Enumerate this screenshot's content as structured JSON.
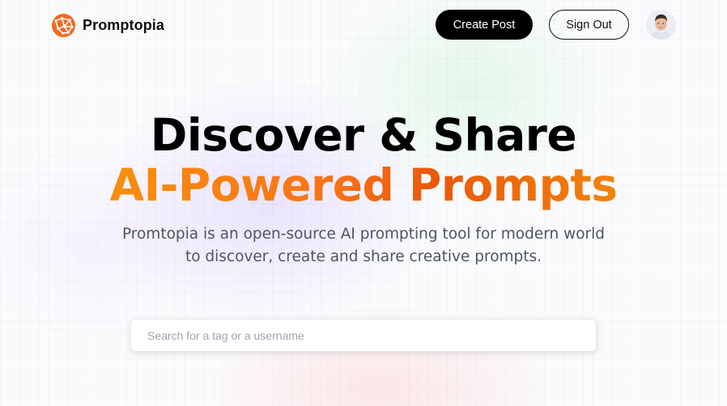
{
  "nav": {
    "brand_name": "Promptopia",
    "create_post_label": "Create Post",
    "sign_out_label": "Sign Out"
  },
  "hero": {
    "headline_line1": "Discover & Share",
    "headline_line2": "AI-Powered Prompts",
    "description": "Promtopia is an open-source AI prompting tool for modern world to discover, create and share creative prompts."
  },
  "search": {
    "placeholder": "Search for a tag or a username",
    "value": ""
  },
  "colors": {
    "brand_orange": "#f97316",
    "gradient_start": "#f59e0b",
    "gradient_mid": "#ea580c",
    "button_dark": "#000000",
    "description_text": "#4b5563"
  },
  "icons": {
    "logo": "promptopia-logo-icon",
    "avatar": "user-avatar"
  }
}
